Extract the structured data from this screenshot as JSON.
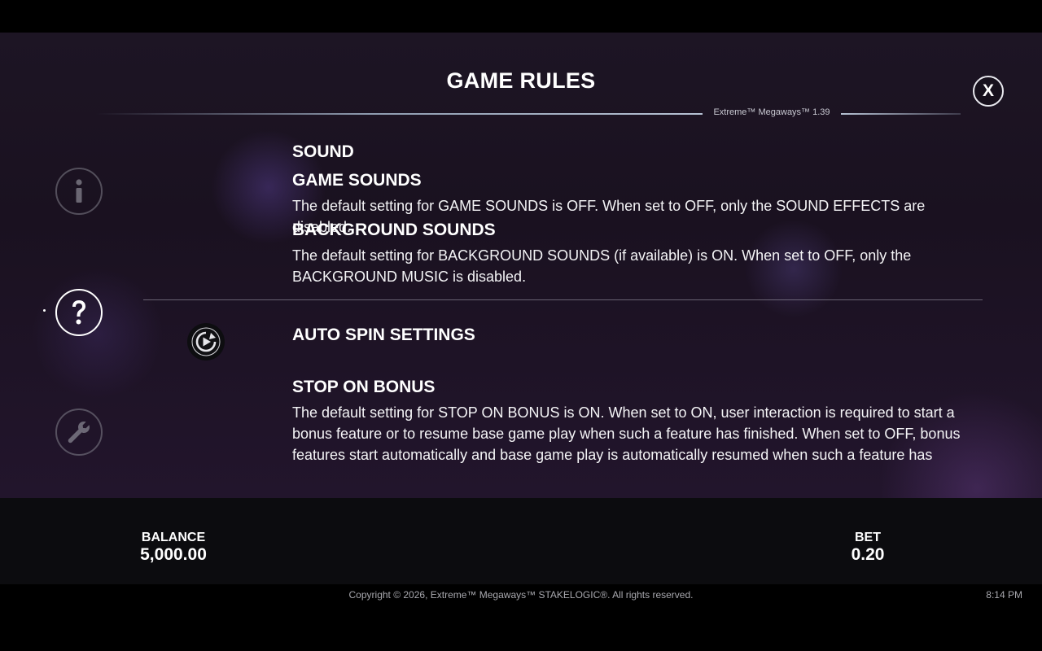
{
  "panel": {
    "title": "GAME RULES",
    "version": "Extreme™ Megaways™ 1.39",
    "close_label": "X"
  },
  "side_nav": {
    "items": [
      {
        "name": "info",
        "icon": "info-icon",
        "state": "inactive"
      },
      {
        "name": "help",
        "icon": "question-icon",
        "state": "active"
      },
      {
        "name": "settings",
        "icon": "wrench-icon",
        "state": "inactive"
      }
    ]
  },
  "content": {
    "sound": {
      "title": "SOUND",
      "game_sounds_title": "GAME SOUNDS",
      "game_sounds_text": "The default setting for GAME SOUNDS is OFF. When set to OFF, only the SOUND EFFECTS are disabled.",
      "background_sounds_title": "BACKGROUND SOUNDS",
      "background_sounds_text": "The default setting for BACKGROUND SOUNDS (if available) is ON. When set to OFF, only the BACKGROUND MUSIC is disabled."
    },
    "auto_spin": {
      "title": "AUTO SPIN SETTINGS",
      "icon": "autospin-icon",
      "stop_on_bonus_title": "STOP ON BONUS",
      "stop_on_bonus_text": "The default setting for STOP ON BONUS is ON. When set to ON, user interaction is required to start a bonus feature or to resume base game play when such a feature has finished. When set to OFF, bonus features start automatically and base game play is automatically resumed when such a feature has finished. Auto spin may be stopped at any time by the player."
    }
  },
  "footer": {
    "balance_label": "BALANCE",
    "balance_value": "5,000.00",
    "bet_label": "BET",
    "bet_value": "0.20",
    "copyright": "Copyright © 2026, Extreme™ Megaways™ STAKELOGIC®. All rights reserved.",
    "clock": "8:14 PM"
  }
}
